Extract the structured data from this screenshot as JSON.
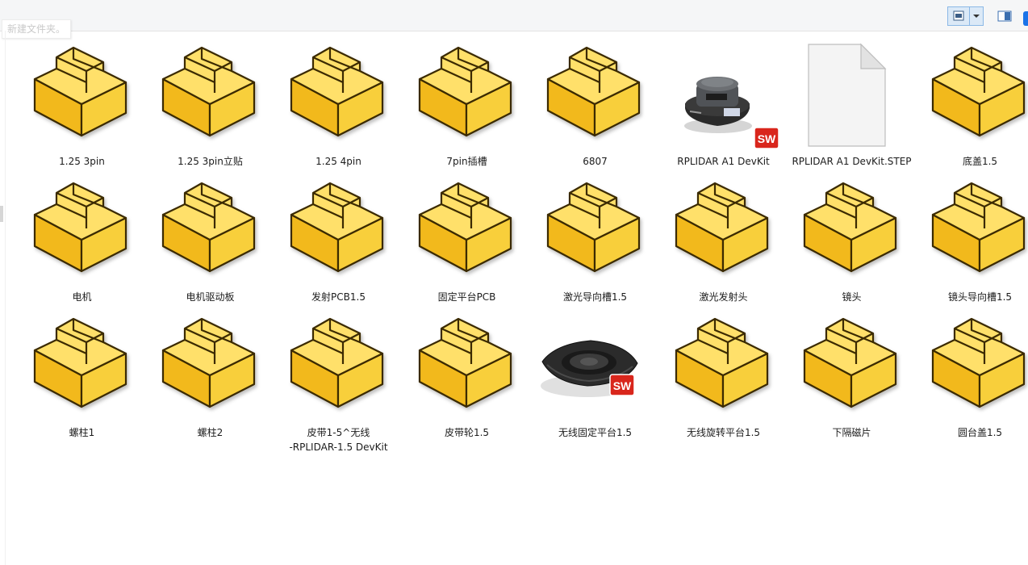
{
  "window": {
    "new_folder_hint": "新建文件夹。"
  },
  "toolbar": {
    "view_icon": "large-icons-view-icon",
    "view_dropdown_icon": "chevron-down-icon",
    "preview_pane_icon": "preview-pane-icon"
  },
  "colors": {
    "part_yellow": "#f7c72a",
    "part_outline": "#3a2a00",
    "sw_badge_red": "#d9261c",
    "selection_blue": "#dbe9f7"
  },
  "files": [
    {
      "name": "1.25 3pin",
      "icon": "solidworks-part-icon"
    },
    {
      "name": "1.25 3pin立贴",
      "icon": "solidworks-part-icon"
    },
    {
      "name": "1.25 4pin",
      "icon": "solidworks-part-icon"
    },
    {
      "name": "7pin插槽",
      "icon": "solidworks-part-icon"
    },
    {
      "name": "6807",
      "icon": "solidworks-part-icon"
    },
    {
      "name": "RPLIDAR A1 DevKit",
      "icon": "solidworks-assembly-thumbnail"
    },
    {
      "name": "RPLIDAR A1 DevKit.STEP",
      "icon": "blank-file-icon"
    },
    {
      "name": "底盖1.5",
      "icon": "solidworks-part-icon"
    },
    {
      "name": "电机",
      "icon": "solidworks-part-icon"
    },
    {
      "name": "电机驱动板",
      "icon": "solidworks-part-icon"
    },
    {
      "name": "发射PCB1.5",
      "icon": "solidworks-part-icon"
    },
    {
      "name": "固定平台PCB",
      "icon": "solidworks-part-icon"
    },
    {
      "name": "激光导向槽1.5",
      "icon": "solidworks-part-icon"
    },
    {
      "name": "激光发射头",
      "icon": "solidworks-part-icon"
    },
    {
      "name": "镜头",
      "icon": "solidworks-part-icon"
    },
    {
      "name": "镜头导向槽1.5",
      "icon": "solidworks-part-icon"
    },
    {
      "name": "螺柱1",
      "icon": "solidworks-part-icon"
    },
    {
      "name": "螺柱2",
      "icon": "solidworks-part-icon"
    },
    {
      "name": "皮带1-5^无线\n-RPLIDAR-1.5 DevKit",
      "icon": "solidworks-part-icon"
    },
    {
      "name": "皮带轮1.5",
      "icon": "solidworks-part-icon"
    },
    {
      "name": "无线固定平台1.5",
      "icon": "solidworks-part-thumbnail"
    },
    {
      "name": "无线旋转平台1.5",
      "icon": "solidworks-part-icon"
    },
    {
      "name": "下隔磁片",
      "icon": "solidworks-part-icon"
    },
    {
      "name": "圆台盖1.5",
      "icon": "solidworks-part-icon"
    }
  ]
}
